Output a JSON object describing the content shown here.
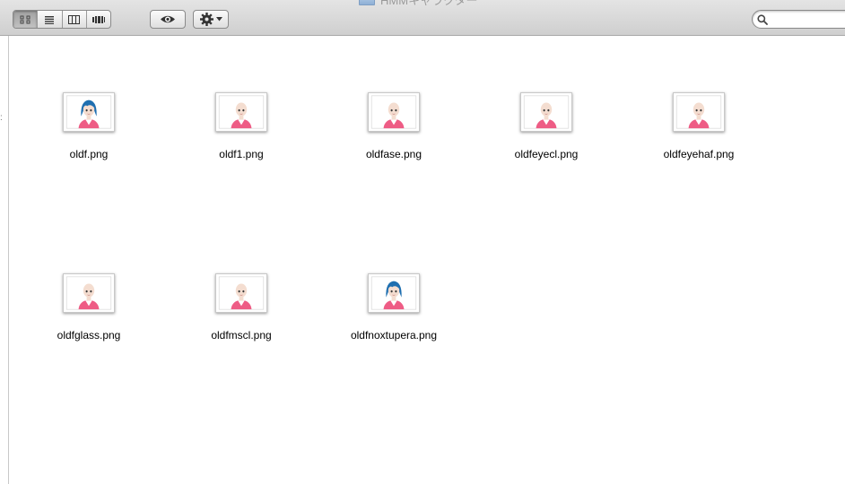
{
  "window": {
    "title": "HMMキャラクター"
  },
  "toolbar": {
    "view_buttons": [
      "icon-view",
      "list-view",
      "column-view",
      "coverflow-view"
    ],
    "active_view": "icon-view",
    "quicklook_icon": "eye-icon",
    "action_icon": "gear-icon",
    "search": {
      "value": "",
      "placeholder": "",
      "icon": "magnifier-icon"
    }
  },
  "colors": {
    "hair": "#1f6fb0",
    "skin": "#f4ddd0",
    "shirt": "#ee5c85",
    "collar": "#ffffff"
  },
  "files": [
    {
      "name": "oldf.png",
      "has_hair": true
    },
    {
      "name": "oldf1.png",
      "has_hair": false
    },
    {
      "name": "oldfase.png",
      "has_hair": false
    },
    {
      "name": "oldfeyecl.png",
      "has_hair": false
    },
    {
      "name": "oldfeyehaf.png",
      "has_hair": false
    },
    {
      "name": "oldfglass.png",
      "has_hair": false
    },
    {
      "name": "oldfmscl.png",
      "has_hair": false
    },
    {
      "name": "oldfnoxtupera.png",
      "has_hair": true
    }
  ]
}
